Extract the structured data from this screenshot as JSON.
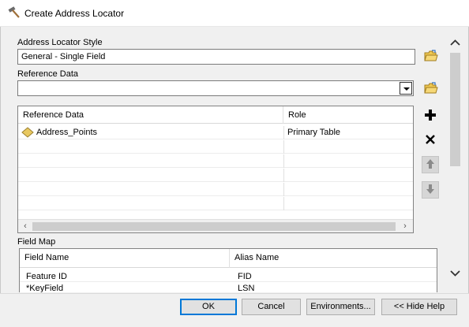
{
  "window": {
    "title": "Create Address Locator",
    "title_icon": "hammer-icon"
  },
  "locator_style": {
    "label": "Address Locator Style",
    "value": "General - Single Field",
    "browse_icon": "open-folder-icon"
  },
  "reference_data": {
    "label": "Reference Data",
    "value": "",
    "browse_icon": "open-folder-icon",
    "table": {
      "columns": [
        "Reference Data",
        "Role"
      ],
      "rows": [
        {
          "name": "Address_Points",
          "role": "Primary Table",
          "icon": "point-feature-class-icon"
        }
      ]
    },
    "actions": {
      "add_icon": "plus-icon",
      "remove_icon": "x-icon",
      "up_icon": "arrow-up-icon",
      "down_icon": "arrow-down-icon"
    }
  },
  "field_map": {
    "label": "Field Map",
    "columns": [
      "Field Name",
      "Alias Name"
    ],
    "rows": [
      {
        "field": "Feature ID",
        "alias": "FID"
      },
      {
        "field": "*KeyField",
        "alias": "LSN"
      }
    ]
  },
  "buttons": {
    "ok": "OK",
    "cancel": "Cancel",
    "environments": "Environments...",
    "hide_help": "<< Hide Help"
  },
  "colors": {
    "accent": "#0078d7",
    "folder_yellow": "#f0c850",
    "feature_yellow": "#e8c860"
  }
}
